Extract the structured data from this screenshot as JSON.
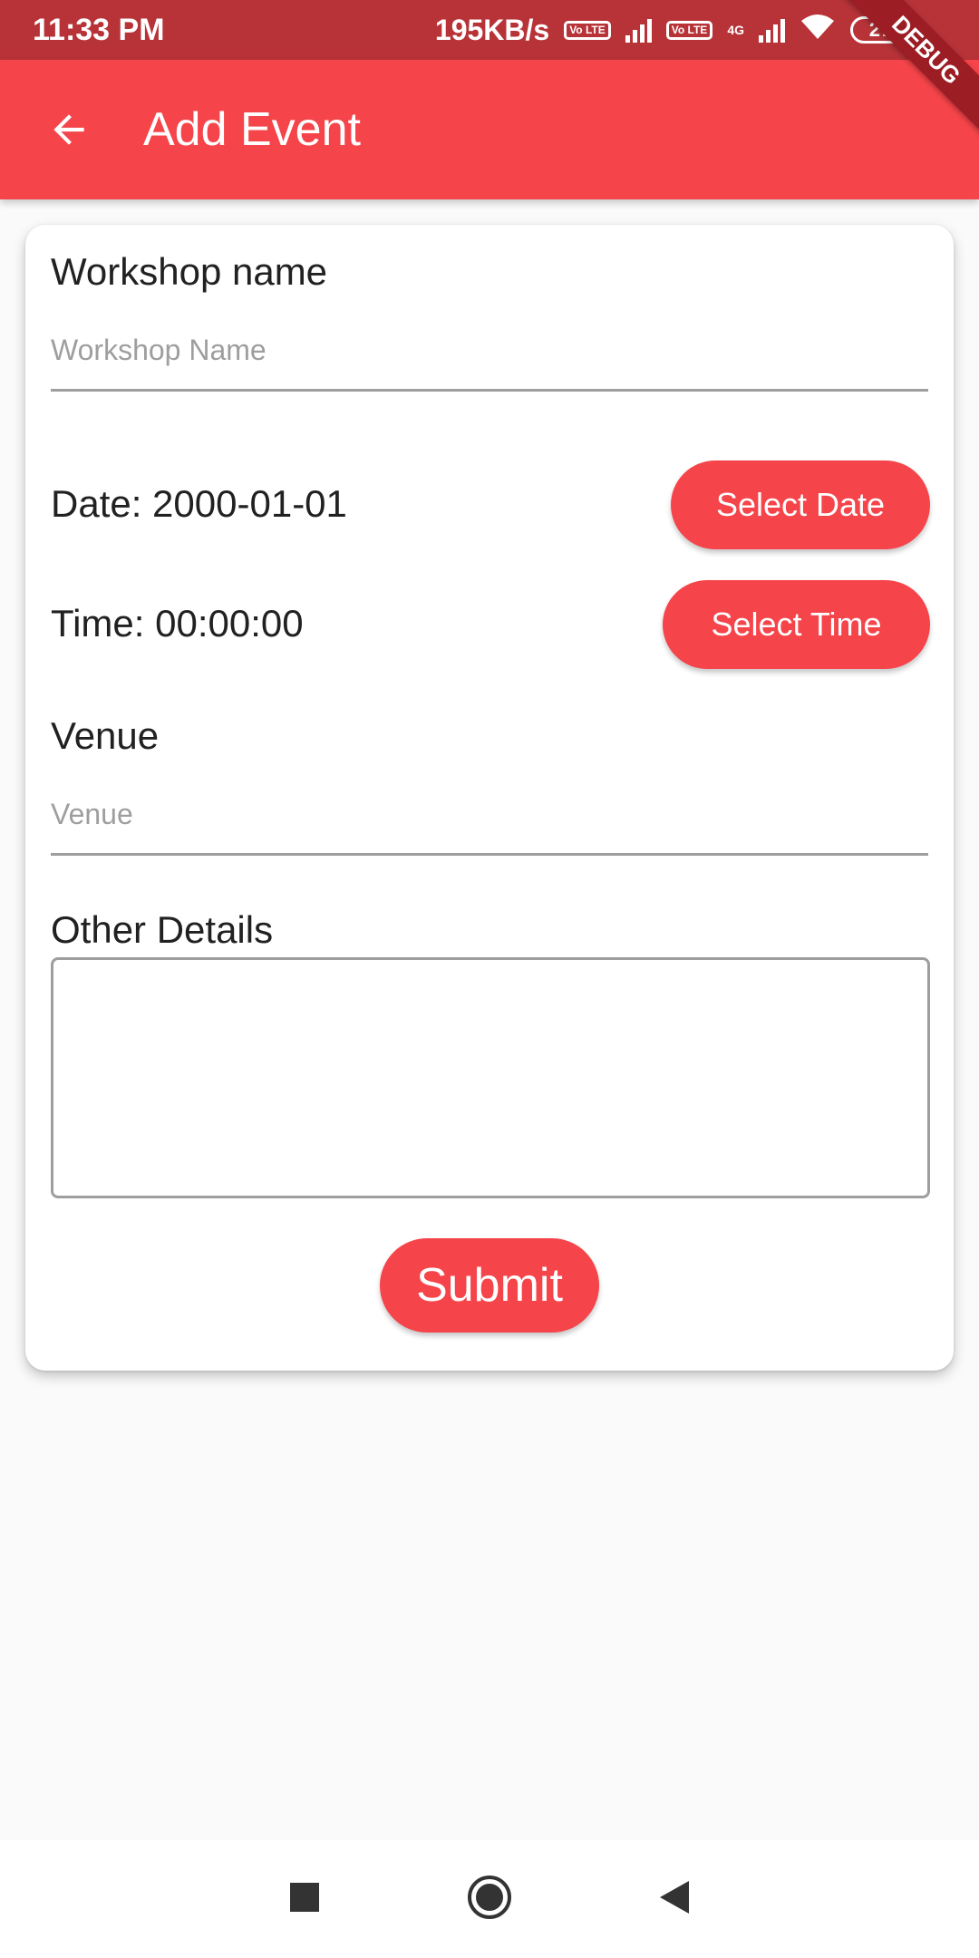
{
  "status_bar": {
    "time": "11:33 PM",
    "net_speed": "195KB/s",
    "sim1_tag": "Vo LTE",
    "sim2_tag": "Vo LTE",
    "network_type": "4G",
    "battery": "27"
  },
  "debug_banner": "DEBUG",
  "app_bar": {
    "title": "Add Event",
    "back_icon": "arrow-left-icon"
  },
  "form": {
    "workshop_label": "Workshop name",
    "workshop_placeholder": "Workshop Name",
    "workshop_value": "",
    "date_label": "Date: 2000-01-01",
    "select_date_label": "Select Date",
    "time_label": "Time: 00:00:00",
    "select_time_label": "Select Time",
    "venue_label": "Venue",
    "venue_placeholder": "Venue",
    "venue_value": "",
    "details_label": "Other Details",
    "details_value": "",
    "submit_label": "Submit"
  },
  "nav": {
    "recent_icon": "square-icon",
    "home_icon": "circle-icon",
    "back_icon": "triangle-back-icon"
  },
  "colors": {
    "accent": "#f5444a",
    "status_bar": "#b83338",
    "background": "#fafafa"
  }
}
